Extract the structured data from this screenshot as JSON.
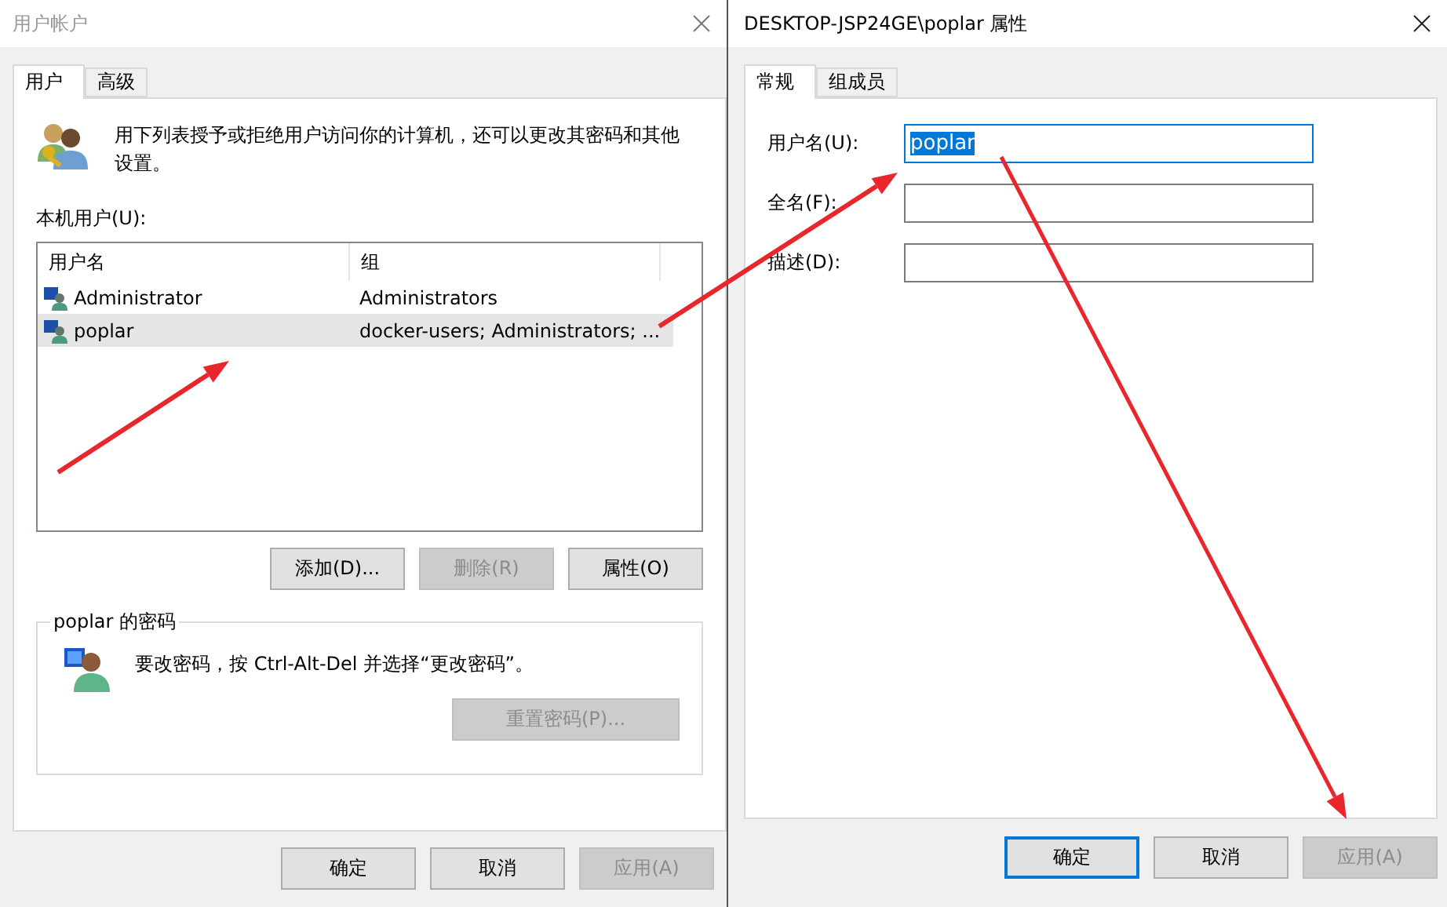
{
  "user_accounts": {
    "title": "用户帐户",
    "active": false,
    "tabs": [
      {
        "label": "用户",
        "selected": true
      },
      {
        "label": "高级",
        "selected": false
      }
    ],
    "description": "用下列表授予或拒绝用户访问你的计算机，还可以更改其密码和其他设置。",
    "list_label": "本机用户(U):",
    "columns": [
      "用户名",
      "组"
    ],
    "users": [
      {
        "name": "Administrator",
        "group": "Administrators",
        "selected": false
      },
      {
        "name": "poplar",
        "group": "docker-users; Administrators; ...",
        "selected": true
      }
    ],
    "list_buttons": [
      {
        "label": "添加(D)...",
        "disabled": false
      },
      {
        "label": "删除(R)",
        "disabled": true
      },
      {
        "label": "属性(O)",
        "disabled": false
      }
    ],
    "password_group": {
      "title": "poplar 的密码",
      "text": "要改密码，按 Ctrl-Alt-Del 并选择“更改密码”。",
      "button": {
        "label": "重置密码(P)...",
        "disabled": true
      }
    },
    "buttons": [
      {
        "label": "确定",
        "disabled": false,
        "default": false
      },
      {
        "label": "取消",
        "disabled": false,
        "default": false
      },
      {
        "label": "应用(A)",
        "disabled": true,
        "default": false
      }
    ]
  },
  "properties": {
    "title": "DESKTOP-JSP24GE\\poplar 属性",
    "active": true,
    "tabs": [
      {
        "label": "常规",
        "selected": true
      },
      {
        "label": "组成员",
        "selected": false
      }
    ],
    "fields": [
      {
        "label": "用户名(U):",
        "value": "poplar",
        "focused": true,
        "value_selected": true
      },
      {
        "label": "全名(F):",
        "focused": false
      },
      {
        "label": "描述(D):",
        "focused": false
      }
    ],
    "buttons": [
      {
        "label": "确定",
        "disabled": false,
        "default": true
      },
      {
        "label": "取消",
        "disabled": false,
        "default": false
      },
      {
        "label": "应用(A)",
        "disabled": true,
        "default": false
      }
    ]
  }
}
